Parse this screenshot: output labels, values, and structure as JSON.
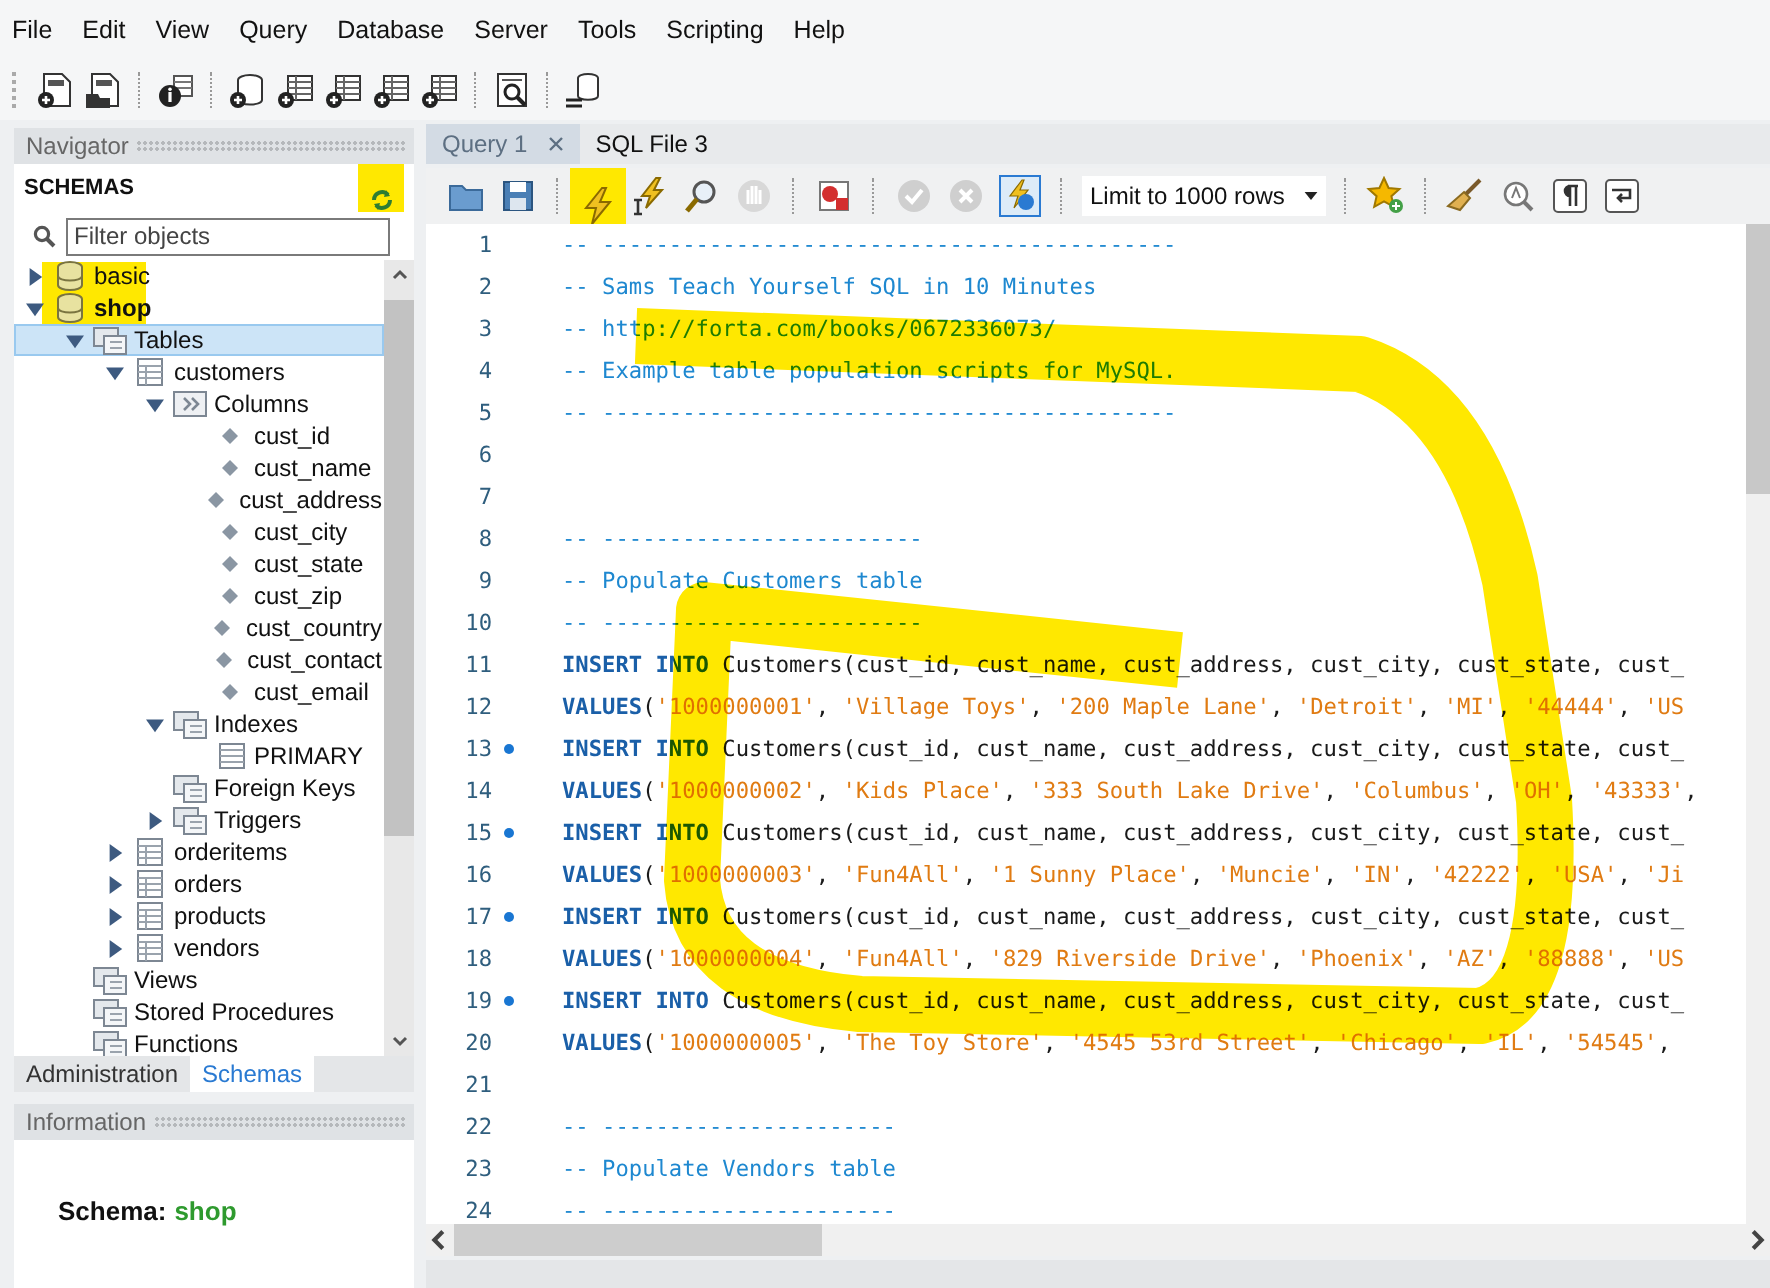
{
  "menu": [
    "File",
    "Edit",
    "View",
    "Query",
    "Database",
    "Server",
    "Tools",
    "Scripting",
    "Help"
  ],
  "navigator": {
    "title": "Navigator",
    "section": "SCHEMAS",
    "filter": {
      "placeholder": "Filter objects"
    },
    "tree": [
      {
        "label": "basic",
        "kind": "schema",
        "expanded": false,
        "selected": false,
        "default": false
      },
      {
        "label": "shop",
        "kind": "schema",
        "expanded": true,
        "selected": false,
        "default": true,
        "children": [
          {
            "label": "Tables",
            "kind": "group",
            "expanded": true,
            "selected": true,
            "children": [
              {
                "label": "customers",
                "kind": "table",
                "expanded": true,
                "selected": false,
                "children": [
                  {
                    "label": "Columns",
                    "kind": "columns",
                    "expanded": true,
                    "selected": false,
                    "children": [
                      {
                        "label": "cust_id",
                        "kind": "column",
                        "selected": false
                      },
                      {
                        "label": "cust_name",
                        "kind": "column",
                        "selected": false
                      },
                      {
                        "label": "cust_address",
                        "kind": "column",
                        "selected": false
                      },
                      {
                        "label": "cust_city",
                        "kind": "column",
                        "selected": false
                      },
                      {
                        "label": "cust_state",
                        "kind": "column",
                        "selected": false
                      },
                      {
                        "label": "cust_zip",
                        "kind": "column",
                        "selected": false
                      },
                      {
                        "label": "cust_country",
                        "kind": "column",
                        "selected": false
                      },
                      {
                        "label": "cust_contact",
                        "kind": "column",
                        "selected": false
                      },
                      {
                        "label": "cust_email",
                        "kind": "column",
                        "selected": false
                      }
                    ]
                  },
                  {
                    "label": "Indexes",
                    "kind": "group",
                    "expanded": true,
                    "selected": false,
                    "children": [
                      {
                        "label": "PRIMARY",
                        "kind": "index",
                        "selected": false
                      }
                    ]
                  },
                  {
                    "label": "Foreign Keys",
                    "kind": "group",
                    "selected": false
                  },
                  {
                    "label": "Triggers",
                    "kind": "group",
                    "expanded": false,
                    "selected": false
                  }
                ]
              },
              {
                "label": "orderitems",
                "kind": "table",
                "expanded": false,
                "selected": false
              },
              {
                "label": "orders",
                "kind": "table",
                "expanded": false,
                "selected": false
              },
              {
                "label": "products",
                "kind": "table",
                "expanded": false,
                "selected": false
              },
              {
                "label": "vendors",
                "kind": "table",
                "expanded": false,
                "selected": false
              }
            ]
          },
          {
            "label": "Views",
            "kind": "group",
            "selected": false
          },
          {
            "label": "Stored Procedures",
            "kind": "group",
            "selected": false
          },
          {
            "label": "Functions",
            "kind": "group",
            "selected": false
          }
        ]
      }
    ],
    "tabs": [
      {
        "label": "Administration",
        "selected": false
      },
      {
        "label": "Schemas",
        "selected": true
      }
    ]
  },
  "information": {
    "title": "Information",
    "label": "Schema:",
    "value": "shop"
  },
  "editor": {
    "tabs": [
      {
        "label": "Query 1",
        "selected": false
      },
      {
        "label": "SQL File 3",
        "selected": true
      }
    ],
    "toolbar": {
      "limit": "Limit to 1000 rows",
      "autocommit": true,
      "commit_enabled": false
    },
    "lines": [
      {
        "number": "1",
        "marker": false,
        "tokens": [
          {
            "kind": "comment",
            "text": "-- -------------------------------------------"
          }
        ]
      },
      {
        "number": "2",
        "marker": false,
        "tokens": [
          {
            "kind": "comment",
            "text": "-- Sams Teach Yourself SQL in 10 Minutes"
          }
        ]
      },
      {
        "number": "3",
        "marker": false,
        "tokens": [
          {
            "kind": "comment",
            "text": "-- http://forta.com/books/0672336073/"
          }
        ]
      },
      {
        "number": "4",
        "marker": false,
        "tokens": [
          {
            "kind": "comment",
            "text": "-- Example table population scripts for MySQL."
          }
        ]
      },
      {
        "number": "5",
        "marker": false,
        "tokens": [
          {
            "kind": "comment",
            "text": "-- -------------------------------------------"
          }
        ]
      },
      {
        "number": "6",
        "marker": false
      },
      {
        "number": "7",
        "marker": false
      },
      {
        "number": "8",
        "marker": false,
        "tokens": [
          {
            "kind": "comment",
            "text": "-- ------------------------"
          }
        ]
      },
      {
        "number": "9",
        "marker": false,
        "tokens": [
          {
            "kind": "comment",
            "text": "-- Populate Customers table"
          }
        ]
      },
      {
        "number": "10",
        "marker": false,
        "tokens": [
          {
            "kind": "comment",
            "text": "-- ------------------------"
          }
        ]
      },
      {
        "number": "11",
        "marker": false,
        "tokens": [
          {
            "kind": "keyword",
            "text": "INSERT INTO"
          },
          {
            "kind": "plain",
            "text": " Customers(cust_id, cust_name, cust_address, cust_city, cust_state, cust_"
          }
        ]
      },
      {
        "number": "12",
        "marker": false,
        "tokens": [
          {
            "kind": "keyword",
            "text": "VALUES"
          },
          {
            "kind": "plain",
            "text": "("
          },
          {
            "kind": "string",
            "text": "'1000000001'"
          },
          {
            "kind": "plain",
            "text": ", "
          },
          {
            "kind": "string",
            "text": "'Village Toys'"
          },
          {
            "kind": "plain",
            "text": ", "
          },
          {
            "kind": "string",
            "text": "'200 Maple Lane'"
          },
          {
            "kind": "plain",
            "text": ", "
          },
          {
            "kind": "string",
            "text": "'Detroit'"
          },
          {
            "kind": "plain",
            "text": ", "
          },
          {
            "kind": "string",
            "text": "'MI'"
          },
          {
            "kind": "plain",
            "text": ", "
          },
          {
            "kind": "string",
            "text": "'44444'"
          },
          {
            "kind": "plain",
            "text": ", "
          },
          {
            "kind": "string",
            "text": "'US"
          }
        ]
      },
      {
        "number": "13",
        "marker": true,
        "tokens": [
          {
            "kind": "keyword",
            "text": "INSERT INTO"
          },
          {
            "kind": "plain",
            "text": " Customers(cust_id, cust_name, cust_address, cust_city, cust_state, cust_"
          }
        ]
      },
      {
        "number": "14",
        "marker": false,
        "tokens": [
          {
            "kind": "keyword",
            "text": "VALUES"
          },
          {
            "kind": "plain",
            "text": "("
          },
          {
            "kind": "string",
            "text": "'1000000002'"
          },
          {
            "kind": "plain",
            "text": ", "
          },
          {
            "kind": "string",
            "text": "'Kids Place'"
          },
          {
            "kind": "plain",
            "text": ", "
          },
          {
            "kind": "string",
            "text": "'333 South Lake Drive'"
          },
          {
            "kind": "plain",
            "text": ", "
          },
          {
            "kind": "string",
            "text": "'Columbus'"
          },
          {
            "kind": "plain",
            "text": ", "
          },
          {
            "kind": "string",
            "text": "'OH'"
          },
          {
            "kind": "plain",
            "text": ", "
          },
          {
            "kind": "string",
            "text": "'43333'"
          },
          {
            "kind": "plain",
            "text": ","
          }
        ]
      },
      {
        "number": "15",
        "marker": true,
        "tokens": [
          {
            "kind": "keyword",
            "text": "INSERT INTO"
          },
          {
            "kind": "plain",
            "text": " Customers(cust_id, cust_name, cust_address, cust_city, cust_state, cust_"
          }
        ]
      },
      {
        "number": "16",
        "marker": false,
        "tokens": [
          {
            "kind": "keyword",
            "text": "VALUES"
          },
          {
            "kind": "plain",
            "text": "("
          },
          {
            "kind": "string",
            "text": "'1000000003'"
          },
          {
            "kind": "plain",
            "text": ", "
          },
          {
            "kind": "string",
            "text": "'Fun4All'"
          },
          {
            "kind": "plain",
            "text": ", "
          },
          {
            "kind": "string",
            "text": "'1 Sunny Place'"
          },
          {
            "kind": "plain",
            "text": ", "
          },
          {
            "kind": "string",
            "text": "'Muncie'"
          },
          {
            "kind": "plain",
            "text": ", "
          },
          {
            "kind": "string",
            "text": "'IN'"
          },
          {
            "kind": "plain",
            "text": ", "
          },
          {
            "kind": "string",
            "text": "'42222'"
          },
          {
            "kind": "plain",
            "text": ", "
          },
          {
            "kind": "string",
            "text": "'USA'"
          },
          {
            "kind": "plain",
            "text": ", "
          },
          {
            "kind": "string",
            "text": "'Ji"
          }
        ]
      },
      {
        "number": "17",
        "marker": true,
        "tokens": [
          {
            "kind": "keyword",
            "text": "INSERT INTO"
          },
          {
            "kind": "plain",
            "text": " Customers(cust_id, cust_name, cust_address, cust_city, cust_state, cust_"
          }
        ]
      },
      {
        "number": "18",
        "marker": false,
        "tokens": [
          {
            "kind": "keyword",
            "text": "VALUES"
          },
          {
            "kind": "plain",
            "text": "("
          },
          {
            "kind": "string",
            "text": "'1000000004'"
          },
          {
            "kind": "plain",
            "text": ", "
          },
          {
            "kind": "string",
            "text": "'Fun4All'"
          },
          {
            "kind": "plain",
            "text": ", "
          },
          {
            "kind": "string",
            "text": "'829 Riverside Drive'"
          },
          {
            "kind": "plain",
            "text": ", "
          },
          {
            "kind": "string",
            "text": "'Phoenix'"
          },
          {
            "kind": "plain",
            "text": ", "
          },
          {
            "kind": "string",
            "text": "'AZ'"
          },
          {
            "kind": "plain",
            "text": ", "
          },
          {
            "kind": "string",
            "text": "'88888'"
          },
          {
            "kind": "plain",
            "text": ", "
          },
          {
            "kind": "string",
            "text": "'US"
          }
        ]
      },
      {
        "number": "19",
        "marker": true,
        "tokens": [
          {
            "kind": "keyword",
            "text": "INSERT INTO"
          },
          {
            "kind": "plain",
            "text": " Customers(cust_id, cust_name, cust_address, cust_city, cust_state, cust_"
          }
        ]
      },
      {
        "number": "20",
        "marker": false,
        "tokens": [
          {
            "kind": "keyword",
            "text": "VALUES"
          },
          {
            "kind": "plain",
            "text": "("
          },
          {
            "kind": "string",
            "text": "'1000000005'"
          },
          {
            "kind": "plain",
            "text": ", "
          },
          {
            "kind": "string",
            "text": "'The Toy Store'"
          },
          {
            "kind": "plain",
            "text": ", "
          },
          {
            "kind": "string",
            "text": "'4545 53rd Street'"
          },
          {
            "kind": "plain",
            "text": ", "
          },
          {
            "kind": "string",
            "text": "'Chicago'"
          },
          {
            "kind": "plain",
            "text": ", "
          },
          {
            "kind": "string",
            "text": "'IL'"
          },
          {
            "kind": "plain",
            "text": ", "
          },
          {
            "kind": "string",
            "text": "'54545'"
          },
          {
            "kind": "plain",
            "text": ","
          }
        ]
      },
      {
        "number": "21",
        "marker": false
      },
      {
        "number": "22",
        "marker": false,
        "tokens": [
          {
            "kind": "comment",
            "text": "-- ----------------------"
          }
        ]
      },
      {
        "number": "23",
        "marker": false,
        "tokens": [
          {
            "kind": "comment",
            "text": "-- Populate Vendors table"
          }
        ]
      },
      {
        "number": "24",
        "marker": false,
        "tokens": [
          {
            "kind": "comment",
            "text": "-- ----------------------"
          }
        ]
      }
    ]
  }
}
